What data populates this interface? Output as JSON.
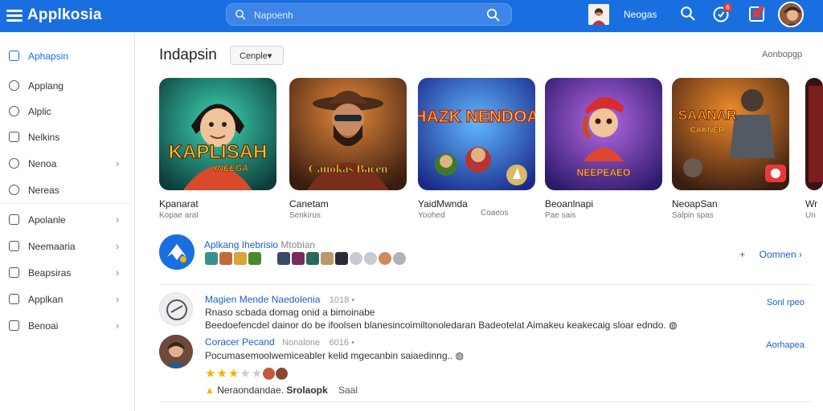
{
  "header": {
    "app_title": "Applkosia",
    "search_placeholder": "Napoenh",
    "user_link": "Neogas",
    "notification_count": "6"
  },
  "sidebar": {
    "items": [
      {
        "label": "Aphapsin",
        "chevron": false
      },
      {
        "label": "Applang",
        "chevron": false
      },
      {
        "label": "Alplic",
        "chevron": false
      },
      {
        "label": "Nelkins",
        "chevron": false
      },
      {
        "label": "Nenoa",
        "chevron": true
      },
      {
        "label": "Nereas",
        "chevron": false
      },
      {
        "label": "Apolanle",
        "chevron": true
      },
      {
        "label": "Neemaaria",
        "chevron": true
      },
      {
        "label": "Beapsiras",
        "chevron": true
      },
      {
        "label": "Applkan",
        "chevron": true
      },
      {
        "label": "Benoai",
        "chevron": true
      }
    ]
  },
  "main": {
    "section_title": "Indapsin",
    "category_button": "Cenple▾",
    "see_all": "Aonbopgp",
    "games": [
      {
        "title_art": "KAPLISAH",
        "title_art_sub": "INEEGA",
        "name": "Kpanarat",
        "subtitle": "Kopae arat"
      },
      {
        "title_art": "Cauokas Bacen",
        "name": "Canetam",
        "subtitle": "Senkirus"
      },
      {
        "title_art": "HAZK NENDOA",
        "name": "YaidMwnda",
        "subtitle": "Yoohed",
        "extra": "Coaeos"
      },
      {
        "title_art": "NEEPEAEO",
        "name": "Beoanlnapi",
        "subtitle": "Pae sais"
      },
      {
        "title_art": "SAANAR",
        "title_art_sub": "CAKNER",
        "name": "NeoapSan",
        "subtitle": "Salpin spas"
      },
      {
        "name": "Wr",
        "subtitle": "Un"
      }
    ]
  },
  "developer": {
    "name": "Aplkang Ihebrisio",
    "meta": "Mtobian",
    "follow_plus": "+",
    "follow_label": "Oomnen ›"
  },
  "reviews": [
    {
      "author": "Magien Mende",
      "title": "Naedolenia",
      "meta": "1018 •",
      "line1": "Rnaso scbada domag onid a bimoinabe",
      "line2": "Beedoefencdel dainor do be ifoolsen blanesincoimiltonoledaran Badeotelat Aimakeu keakecaig sloar edndo. ◍",
      "action": "Sonl rpeo"
    },
    {
      "author": "Coracer Pecand",
      "title": "Nonalone",
      "meta": "6016 •",
      "line1": "Pocumasemoolwemiceabler kelid mgecanbin saiaedinng.. ◍",
      "rating": 3,
      "max_rating": 5,
      "footer_name": "Neraondandae.",
      "footer_bold": "Srolaopk",
      "footer_sub": "Saal",
      "action": "Aorhapea"
    }
  ],
  "colors": {
    "header_bg": "#1a6fe0",
    "link": "#1a5fc8",
    "star": "#f2b500"
  }
}
